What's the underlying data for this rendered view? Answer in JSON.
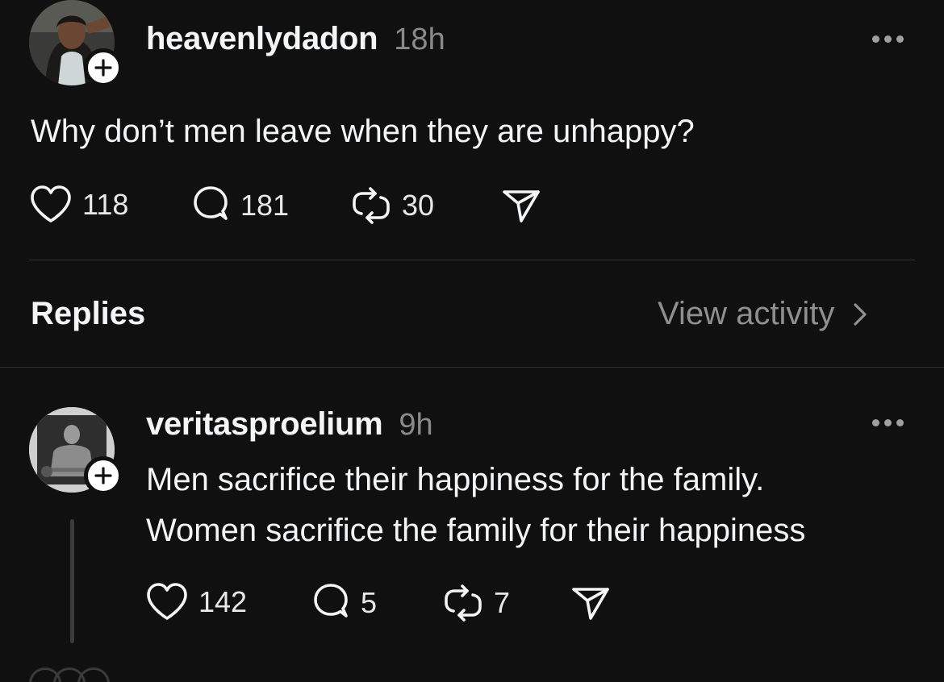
{
  "main_post": {
    "username": "heavenlydadon",
    "time": "18h",
    "text": "Why don’t men leave when they are unhappy?",
    "likes": "118",
    "comments": "181",
    "reposts": "30",
    "avatar_icon": "user-photo-icon"
  },
  "replies_header": {
    "label": "Replies",
    "view_activity": "View activity"
  },
  "reply": {
    "username": "veritasproelium",
    "time": "9h",
    "text_line1": "Men sacrifice their happiness for the family.",
    "text_line2": "Women sacrifice the family for their happiness",
    "likes": "142",
    "comments": "5",
    "reposts": "7",
    "avatar_icon": "user-photo-icon"
  },
  "colors": {
    "background": "#101010",
    "text": "#f3f5f7",
    "secondary": "#8a8a8a",
    "divider": "#323232"
  }
}
